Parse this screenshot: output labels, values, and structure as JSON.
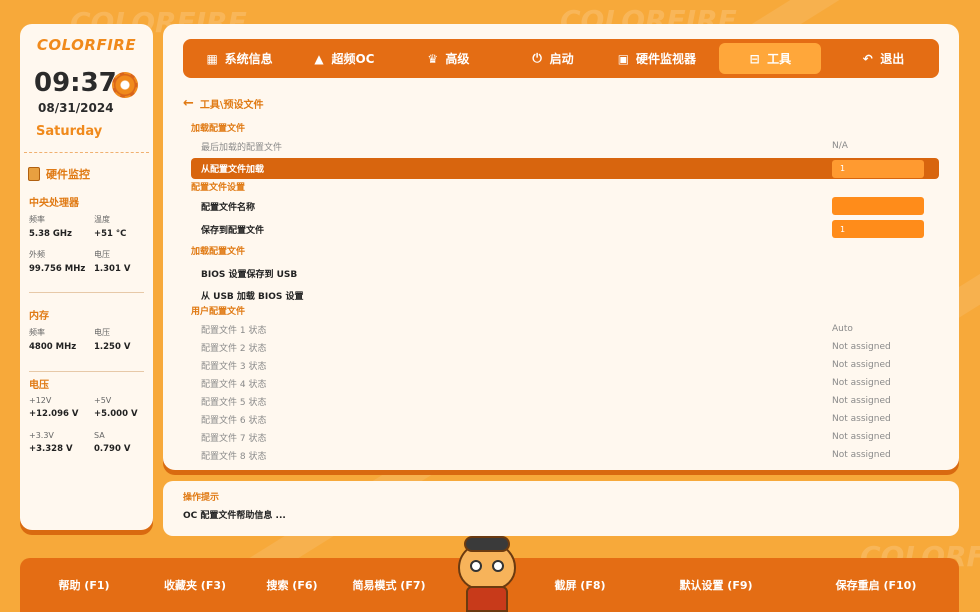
{
  "brand": "COLORFIRE",
  "background_words": [
    "COLORFIRE",
    "COLORFIRE",
    "COLORFIRE"
  ],
  "clock": {
    "time": "09:37",
    "date": "08/31/2024",
    "day": "Saturday"
  },
  "hw_monitor": {
    "title": "硬件监控",
    "cpu": {
      "title": "中央处理器",
      "freq_label": "频率",
      "freq": "5.38 GHz",
      "temp_label": "温度",
      "temp": "+51 °C",
      "ext_label": "外频",
      "ext": "99.756 MHz",
      "volt_label": "电压",
      "volt": "1.301 V"
    },
    "memory": {
      "title": "内存",
      "freq_label": "频率",
      "freq": "4800 MHz",
      "volt_label": "电压",
      "volt": "1.250 V"
    },
    "voltage": {
      "title": "电压",
      "v12_label": "+12V",
      "v12": "+12.096 V",
      "v5_label": "+5V",
      "v5": "+5.000 V",
      "v33_label": "+3.3V",
      "v33": "+3.328 V",
      "sa_label": "SA",
      "sa": "0.790 V"
    }
  },
  "tabs": [
    {
      "label": "系统信息",
      "icon": "grid-icon"
    },
    {
      "label": "超频OC",
      "icon": "rocket-icon"
    },
    {
      "label": "高级",
      "icon": "crown-icon"
    },
    {
      "label": "启动",
      "icon": "power-icon"
    },
    {
      "label": "硬件监视器",
      "icon": "monitor-icon"
    },
    {
      "label": "工具",
      "icon": "toolbox-icon",
      "active": true
    },
    {
      "label": "退出",
      "icon": "back-icon"
    }
  ],
  "breadcrumb": "工具\\预设文件",
  "settings": {
    "sec_load": "加载配置文件",
    "last_loaded_label": "最后加载的配置文件",
    "last_loaded_value": "N/A",
    "load_from_label": "从配置文件加载",
    "load_from_value": "1",
    "sec_settings": "配置文件设置",
    "name_label": "配置文件名称",
    "name_value": "",
    "save_to_label": "保存到配置文件",
    "save_to_value": "1",
    "sec_load2": "加载配置文件",
    "bios_save_usb": "BIOS 设置保存到 USB",
    "bios_load_usb": "从 USB 加载 BIOS 设置",
    "sec_user": "用户配置文件",
    "profiles": [
      {
        "label": "配置文件 1 状态",
        "value": "Auto"
      },
      {
        "label": "配置文件 2 状态",
        "value": "Not assigned"
      },
      {
        "label": "配置文件 3 状态",
        "value": "Not assigned"
      },
      {
        "label": "配置文件 4 状态",
        "value": "Not assigned"
      },
      {
        "label": "配置文件 5 状态",
        "value": "Not assigned"
      },
      {
        "label": "配置文件 6 状态",
        "value": "Not assigned"
      },
      {
        "label": "配置文件 7 状态",
        "value": "Not assigned"
      },
      {
        "label": "配置文件 8 状态",
        "value": "Not assigned"
      }
    ]
  },
  "help": {
    "title": "操作提示",
    "text": "OC 配置文件帮助信息 ..."
  },
  "fkeys": [
    {
      "label": "帮助 (F1)"
    },
    {
      "label": "收藏夹 (F3)"
    },
    {
      "label": "搜索 (F6)"
    },
    {
      "label": "简易模式 (F7)"
    },
    {
      "label": "截屏 (F8)"
    },
    {
      "label": "默认设置 (F9)"
    },
    {
      "label": "保存重启 (F10)"
    }
  ],
  "colors": {
    "accent": "#e46d14",
    "highlight": "#ffa73a",
    "panel": "#fff8ef",
    "background": "#f7a93a"
  }
}
